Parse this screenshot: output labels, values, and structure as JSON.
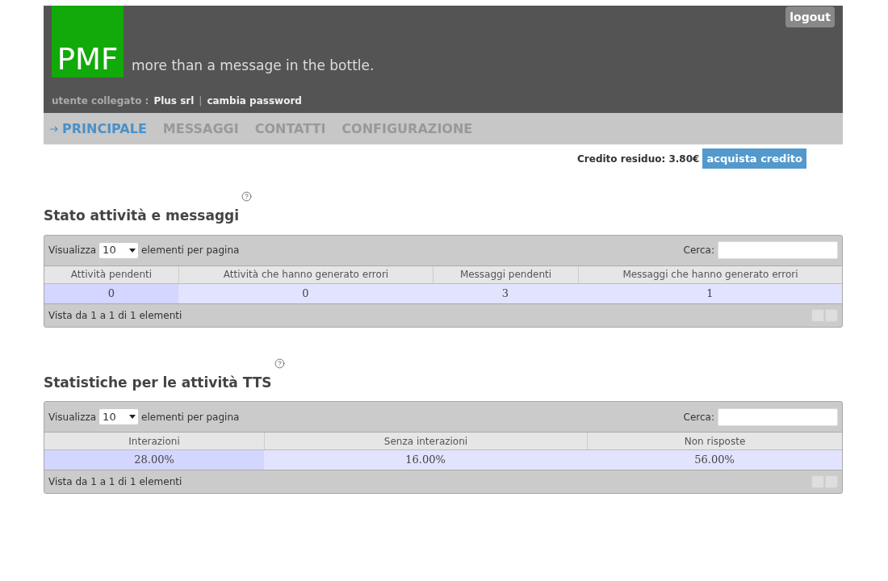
{
  "header": {
    "logo": "PMF",
    "tagline": "more than a message in the bottle.",
    "logout": "logout",
    "user_label": "utente collegato :",
    "user_name": "Plus srl",
    "separator": "|",
    "change_password": "cambia password"
  },
  "nav": [
    {
      "label": "PRINCIPALE",
      "selected": true
    },
    {
      "label": "MESSAGGI",
      "selected": false
    },
    {
      "label": "CONTATTI",
      "selected": false
    },
    {
      "label": "CONFIGURAZIONE",
      "selected": false
    }
  ],
  "credit": {
    "label": "Credito residuo: 3.80€",
    "button": "acquista credito"
  },
  "sections": [
    {
      "title": "Stato attività e messaggi",
      "show_label": "Visualizza",
      "page_size": "10",
      "per_page_label": "elementi per pagina",
      "search_label": "Cerca:",
      "columns": [
        "Attività pendenti",
        "Attività che hanno generato errori",
        "Messaggi pendenti",
        "Messaggi che hanno generato errori"
      ],
      "rows": [
        [
          "0",
          "0",
          "3",
          "1"
        ]
      ],
      "info": "Vista da 1 a 1 di 1 elementi"
    },
    {
      "title": "Statistiche per le attività TTS",
      "show_label": "Visualizza",
      "page_size": "10",
      "per_page_label": "elementi per pagina",
      "search_label": "Cerca:",
      "columns": [
        "Interazioni",
        "Senza interazioni",
        "Non risposte"
      ],
      "rows": [
        [
          "28.00%",
          "16.00%",
          "56.00%"
        ]
      ],
      "info": "Vista da 1 a 1 di 1 elementi"
    }
  ]
}
